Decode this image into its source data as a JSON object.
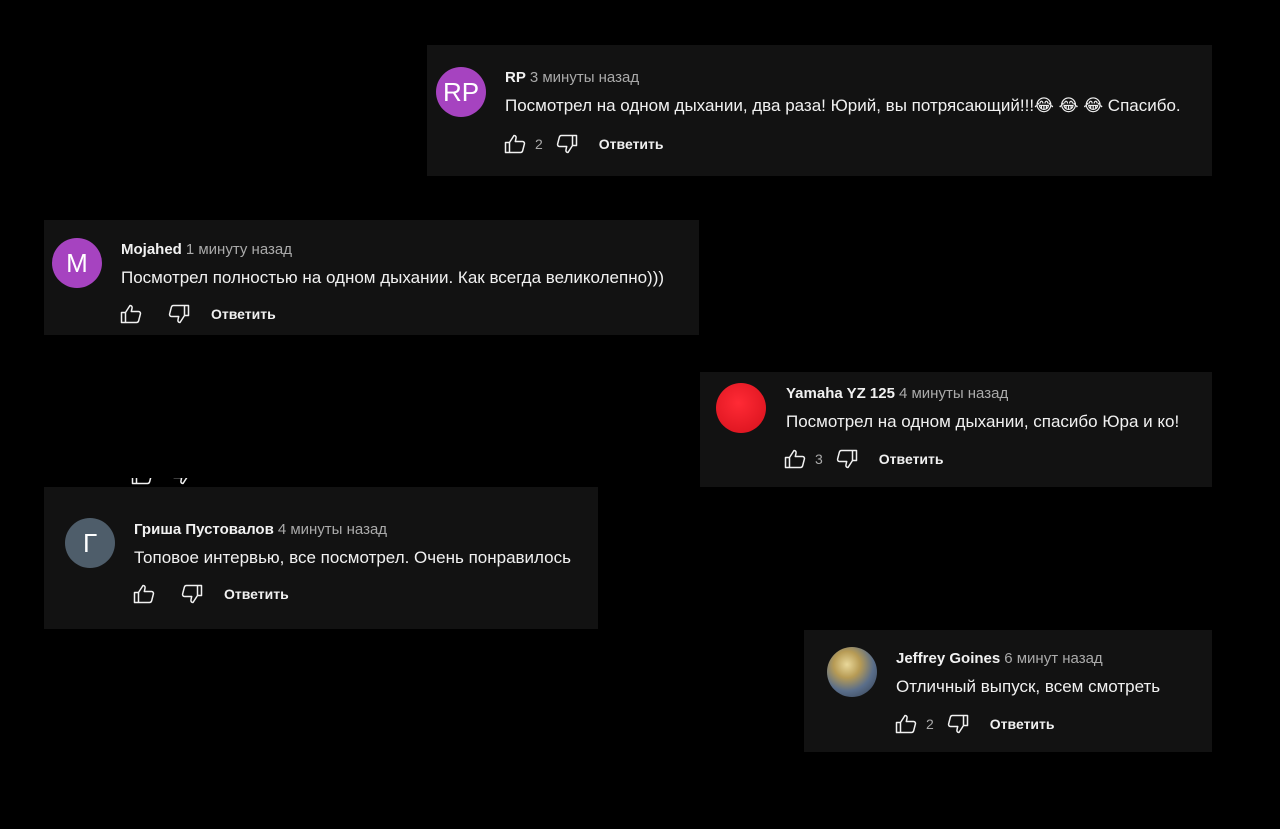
{
  "comments": [
    {
      "avatar_initials": "RP",
      "avatar_color": "#a643c0",
      "author": "RP",
      "time": "3 минуты назад",
      "text": "Посмотрел на одном дыхании, два раза! Юрий, вы потрясающий!!!😂 😂 😂  Спасибо.",
      "likes": "2",
      "reply_label": "Ответить"
    },
    {
      "avatar_initials": "M",
      "avatar_color": "#a643c0",
      "author": "Mojahed",
      "time": "1 минуту назад",
      "text": "Посмотрел полностью на одном дыхании. Как всегда великолепно)))",
      "likes": "",
      "reply_label": "Ответить"
    },
    {
      "avatar_initials": "",
      "avatar_color": "#e8101e",
      "author": "Yamaha YZ 125",
      "time": "4 минуты назад",
      "text": "Посмотрел на одном дыхании, спасибо Юра и ко!",
      "likes": "3",
      "reply_label": "Ответить"
    },
    {
      "avatar_initials": "Г",
      "avatar_color": "#4e5d6a",
      "author": "Гриша Пустовалов",
      "time": "4 минуты назад",
      "text": "Топовое интервью, все посмотрел. Очень понравилось",
      "likes": "",
      "reply_label": "Ответить"
    },
    {
      "avatar_initials": "",
      "avatar_color": "#8a7a4a",
      "author": "Jeffrey Goines",
      "time": "6 минут назад",
      "text": "Отличный выпуск, всем смотреть",
      "likes": "2",
      "reply_label": "Ответить"
    }
  ],
  "icons": {
    "like": "thumbs-up-icon",
    "dislike": "thumbs-down-icon"
  }
}
